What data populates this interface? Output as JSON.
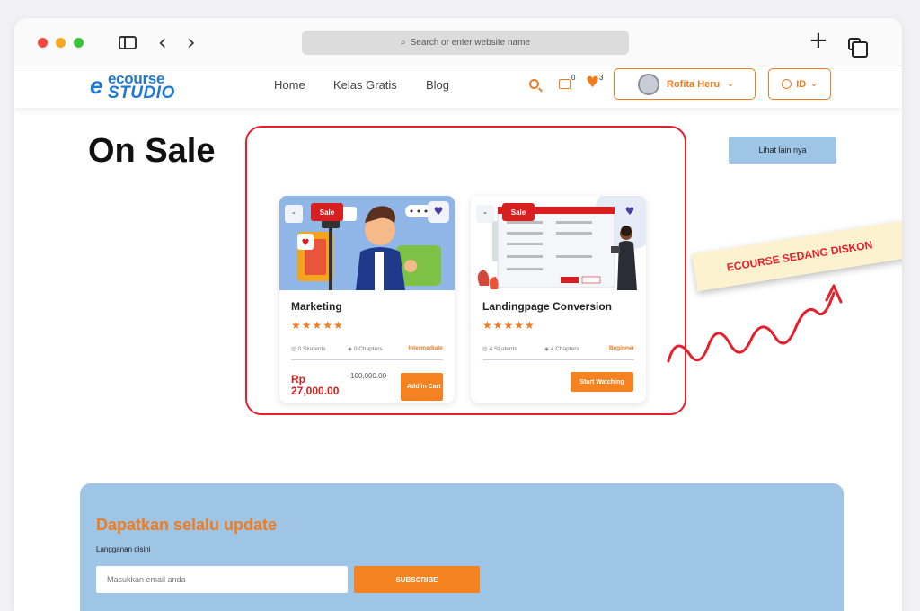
{
  "browser": {
    "url_placeholder": "Search or enter website name"
  },
  "header": {
    "logo_top": "ecourse",
    "logo_bottom": "STUDIO",
    "nav": [
      "Home",
      "Kelas Gratis",
      "Blog"
    ],
    "cart_count": "0",
    "wishlist_count": "3",
    "user_name": "Rofita Heru",
    "language": "ID"
  },
  "main": {
    "section_title": "On Sale",
    "see_more": "Lihat lain nya",
    "callout": "ECOURSE SEDANG DISKON",
    "cards": [
      {
        "sale_tag": "Sale",
        "title": "Marketing",
        "rating": 5,
        "stars": "★★★★★",
        "students": "0 Students",
        "chapters": "0 Chapters",
        "level": "Intermediate",
        "price": "Rp 27,000.00",
        "old_price": "100,000.00",
        "button": "Add in Cart"
      },
      {
        "sale_tag": "Sale",
        "title": "Landingpage Conversion",
        "rating": 5,
        "stars": "★★★★★",
        "students": "4 Students",
        "chapters": "4 Chapters",
        "level": "Beginner",
        "button": "Start Watching"
      }
    ]
  },
  "newsletter": {
    "title": "Dapatkan selalu update",
    "subtitle": "Langganan disini",
    "email_placeholder": "Masukkan email anda",
    "button": "SUBSCRIBE"
  },
  "colors": {
    "accent": "#f07c1f",
    "brand_blue": "#1f78d1",
    "sale_red": "#d81e1e",
    "highlight_red": "#e4202c",
    "newsletter_bg": "#9ec4e6"
  }
}
